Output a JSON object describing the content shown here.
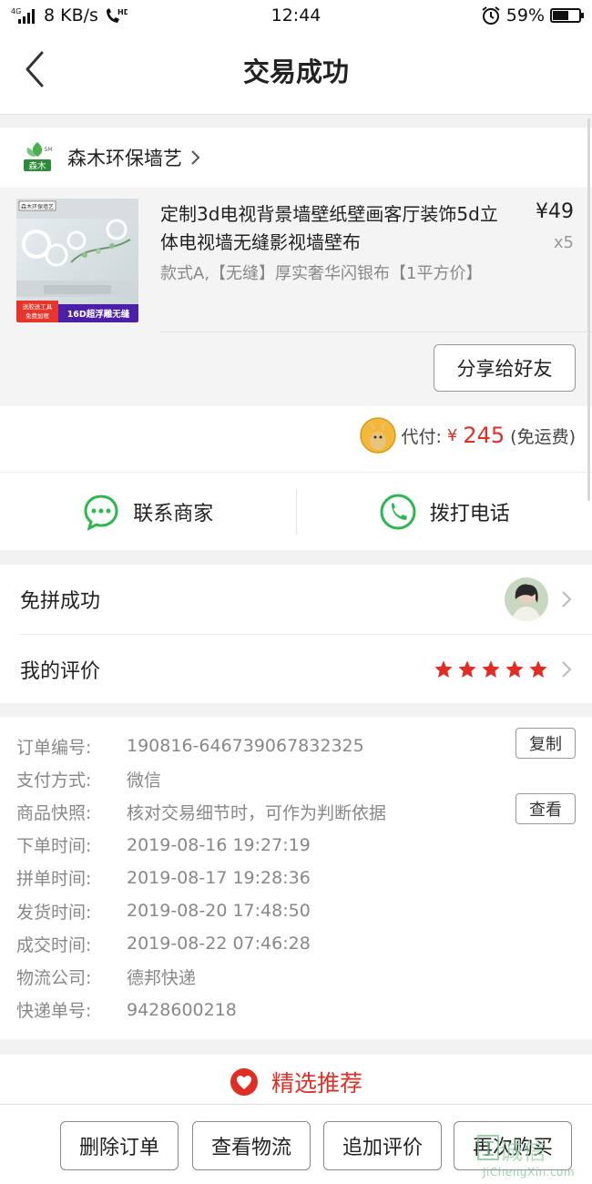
{
  "status_bar": {
    "network": "4G",
    "speed": "8 KB/s",
    "hd": "HD",
    "time": "12:44",
    "battery": "59%",
    "battery_level": 0.59
  },
  "header": {
    "title": "交易成功"
  },
  "shop": {
    "name": "森木环保墙艺",
    "logo_text": "森木",
    "logo_sm": "SM"
  },
  "product": {
    "title": "定制3d电视背景墙壁纸壁画客厅装饰5d立体电视墙无缝影视墙壁布",
    "spec": "款式A,【无缝】厚实奢华闪银布【1平方价】",
    "price": "¥49",
    "qty": "x5",
    "thumb_banner": "16D超浮雕无缝",
    "thumb_tag1": "送胶送工具",
    "thumb_tag2": "免费加框",
    "thumb_brand": "森木环保墙艺"
  },
  "share_button": "分享给好友",
  "payment": {
    "label": "代付:",
    "currency": "¥",
    "amount": "245",
    "note": "(免运费)"
  },
  "contact": {
    "merchant": "联系商家",
    "phone": "拨打电话"
  },
  "group": {
    "label": "免拼成功"
  },
  "review": {
    "label": "我的评价",
    "stars": 5
  },
  "order_info": {
    "rows": [
      {
        "label": "订单编号:",
        "value": "190816-646739067832325"
      },
      {
        "label": "支付方式:",
        "value": "微信"
      },
      {
        "label": "商品快照:",
        "value": "核对交易细节时，可作为判断依据"
      },
      {
        "label": "下单时间:",
        "value": "2019-08-16 19:27:19"
      },
      {
        "label": "拼单时间:",
        "value": "2019-08-17 19:28:36"
      },
      {
        "label": "发货时间:",
        "value": "2019-08-20 17:48:50"
      },
      {
        "label": "成交时间:",
        "value": "2019-08-22 07:46:28"
      },
      {
        "label": "物流公司:",
        "value": "德邦快递"
      },
      {
        "label": "快递单号:",
        "value": "9428600218"
      }
    ],
    "copy_button": "复制",
    "view_button": "查看"
  },
  "recommend": {
    "label": "精选推荐"
  },
  "bottom_bar": {
    "delete": "删除订单",
    "logistics": "查看物流",
    "add_review": "追加评价",
    "rebuy": "再次购买"
  },
  "watermark": {
    "text": "诚信",
    "sub": "JiChengXin.com"
  },
  "colors": {
    "accent": "#e02e24",
    "green": "#2db84d"
  }
}
